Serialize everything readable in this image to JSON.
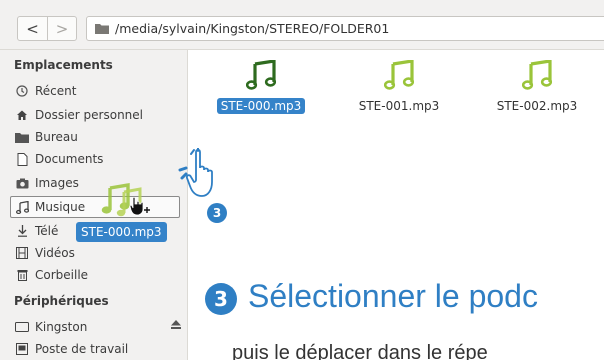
{
  "toolbar": {
    "back_label": "<",
    "forward_label": ">",
    "path": "/media/sylvain/Kingston/STEREO/FOLDER01"
  },
  "sidebar": {
    "places_header": "Emplacements",
    "items": [
      {
        "label": "Récent",
        "icon": "clock-icon"
      },
      {
        "label": "Dossier personnel",
        "icon": "home-icon"
      },
      {
        "label": "Bureau",
        "icon": "folder-icon"
      },
      {
        "label": "Documents",
        "icon": "document-icon"
      },
      {
        "label": "Images",
        "icon": "camera-icon"
      },
      {
        "label": "Musique",
        "icon": "music-icon"
      },
      {
        "label": "Télé",
        "icon": "download-icon"
      },
      {
        "label": "Vidéos",
        "icon": "film-icon"
      },
      {
        "label": "Corbeille",
        "icon": "trash-icon"
      }
    ],
    "devices_header": "Périphériques",
    "devices": [
      {
        "label": "Kingston",
        "icon": "drive-icon"
      },
      {
        "label": "Poste de travail",
        "icon": "computer-icon"
      }
    ]
  },
  "files": [
    {
      "name": "STE-000.mp3",
      "selected": true,
      "color": "#2e6b1f"
    },
    {
      "name": "STE-001.mp3",
      "selected": false,
      "color": "#9ac43a"
    },
    {
      "name": "STE-002.mp3",
      "selected": false,
      "color": "#9ac43a"
    }
  ],
  "drag": {
    "label": "STE-000.mp3"
  },
  "tutorial": {
    "step_number": "3",
    "headline": "Sélectionner le podc",
    "subline": "puis le déplacer dans le répe"
  },
  "colors": {
    "accent": "#2f7fc4",
    "selection": "#3583c9"
  }
}
